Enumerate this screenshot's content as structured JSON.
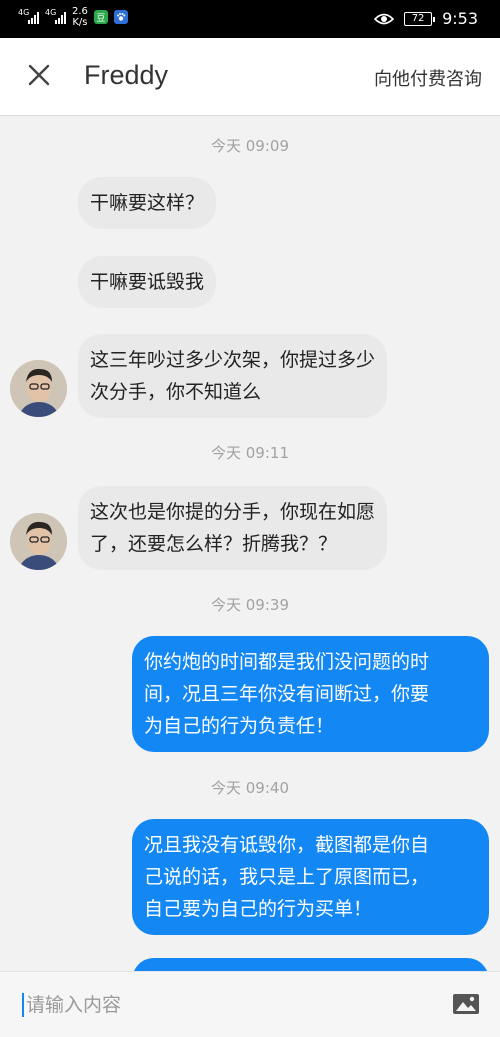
{
  "status_bar": {
    "network1": "4G",
    "network2": "4G",
    "speed_value": "2.6",
    "speed_unit": "K/s",
    "app_badge_text": "豆",
    "battery": "72",
    "time": "9:53"
  },
  "header": {
    "title": "Freddy",
    "consult_label": "向他付费咨询"
  },
  "messages": {
    "t1": "今天 09:09",
    "m1": "干嘛要这样？",
    "m2": "干嘛要诋毁我",
    "m3_l1": "这三年吵过多少次架，你提过多少",
    "m3_l2": "次分手，你不知道么",
    "t2": "今天 09:11",
    "m4_l1": "这次也是你提的分手，你现在如愿",
    "m4_l2": "了，还要怎么样？折腾我？？",
    "t3": "今天 09:39",
    "m5_l1": "你约炮的时间都是我们没问题的时",
    "m5_l2": "间，况且三年你没有间断过，你要",
    "m5_l3": "为自己的行为负责任！",
    "t4": "今天 09:40",
    "m6_l1": "况且我没有诋毁你，截图都是你自",
    "m6_l2": "己说的话，我只是上了原图而已，",
    "m6_l3": "自己要为自己的行为买单！"
  },
  "input": {
    "placeholder": "请输入内容"
  },
  "colors": {
    "outgoing_bubble": "#1388f5",
    "incoming_bubble": "#e9e9e9"
  },
  "icons": {
    "close": "close-icon",
    "image": "image-icon",
    "eye": "eye-icon"
  }
}
